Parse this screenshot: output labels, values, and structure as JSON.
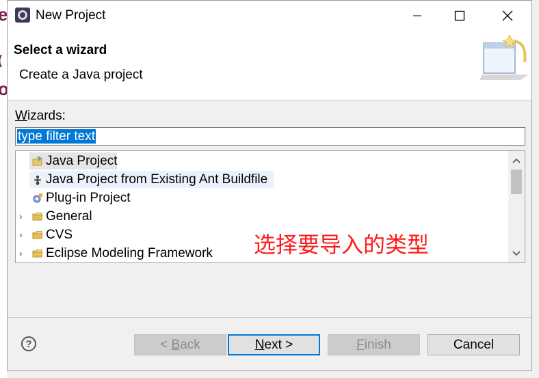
{
  "window": {
    "title": "New Project",
    "controls": {
      "minimize": "—",
      "maximize": "☐",
      "close": "✕"
    }
  },
  "header": {
    "title": "Select a wizard",
    "description": "Create a Java project"
  },
  "wizards": {
    "label_mnemonic": "W",
    "label_rest": "izards:",
    "filter_placeholder": "type filter text",
    "filter_value": "type filter text",
    "items": [
      {
        "label": "Java Project",
        "icon": "java-project-icon",
        "expandable": false
      },
      {
        "label": "Java Project from Existing Ant Buildfile",
        "icon": "ant-icon",
        "expandable": false
      },
      {
        "label": "Plug-in Project",
        "icon": "plugin-icon",
        "expandable": false
      },
      {
        "label": "General",
        "icon": "folder-icon",
        "expandable": true
      },
      {
        "label": "CVS",
        "icon": "folder-icon",
        "expandable": true
      },
      {
        "label": "Eclipse Modeling Framework",
        "icon": "folder-icon",
        "expandable": true
      }
    ]
  },
  "annotation": "选择要导入的类型",
  "buttons": {
    "back_prefix": "< ",
    "back_mnemonic": "B",
    "back_rest": "ack",
    "next_mnemonic": "N",
    "next_rest": "ext >",
    "finish_mnemonic": "F",
    "finish_rest": "inish",
    "cancel": "Cancel",
    "help": "?"
  },
  "colors": {
    "selection": "#0078d7",
    "annotation": "#ff1a1a",
    "default_button_border": "#0078d7"
  }
}
